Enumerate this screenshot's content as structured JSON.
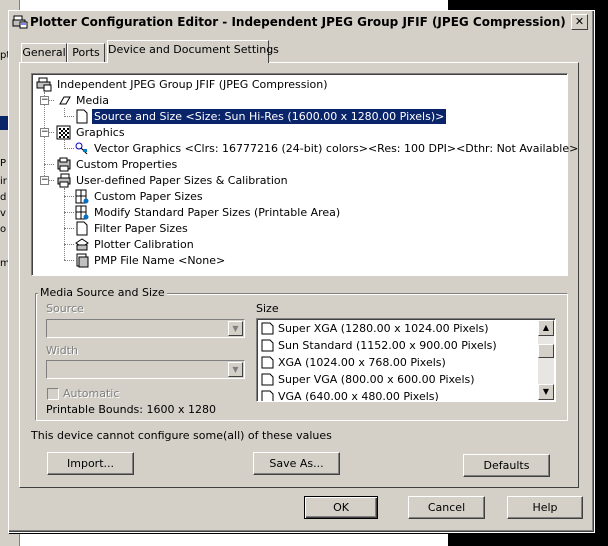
{
  "background": {
    "left_fragments": [
      "pt",
      "P",
      "ir",
      "d",
      "v",
      "o",
      "m"
    ]
  },
  "window": {
    "title": "Plotter Configuration Editor - Independent JPEG Group JFIF (JPEG Compression)",
    "close_label": "✕"
  },
  "tabs": [
    {
      "label": "General"
    },
    {
      "label": "Ports"
    },
    {
      "label": "Device and Document Settings"
    }
  ],
  "tree": {
    "root": "Independent JPEG Group JFIF (JPEG Compression)",
    "media": "Media",
    "source_size": "Source and Size <Size: Sun Hi-Res (1600.00 x 1280.00 Pixels)>",
    "graphics": "Graphics",
    "vector_graphics": "Vector Graphics <Clrs: 16777216  (24-bit) colors><Res: 100 DPI><Dthr: Not Available>",
    "custom_properties": "Custom Properties",
    "user_defined": "User-defined Paper Sizes & Calibration",
    "custom_paper": "Custom Paper Sizes",
    "modify_standard": "Modify Standard Paper Sizes (Printable Area)",
    "filter_paper": "Filter Paper Sizes",
    "plotter_calibration": "Plotter Calibration",
    "pmp_file": "PMP File Name <None>"
  },
  "media_group": {
    "title": "Media Source and Size",
    "source_label": "Source",
    "width_label": "Width",
    "automatic_label": "Automatic",
    "printable_bounds": "Printable Bounds: 1600 x 1280",
    "size_label": "Size",
    "sizes": [
      "Super XGA (1280.00 x 1024.00 Pixels)",
      "Sun Standard (1152.00 x 900.00 Pixels)",
      "XGA (1024.00 x 768.00 Pixels)",
      "Super VGA (800.00 x 600.00 Pixels)",
      "VGA (640.00 x 480.00 Pixels)"
    ]
  },
  "message": "This device cannot configure some(all) of these values",
  "buttons": {
    "import": "Import...",
    "save_as": "Save As...",
    "defaults": "Defaults",
    "ok": "OK",
    "cancel": "Cancel",
    "help": "Help"
  }
}
